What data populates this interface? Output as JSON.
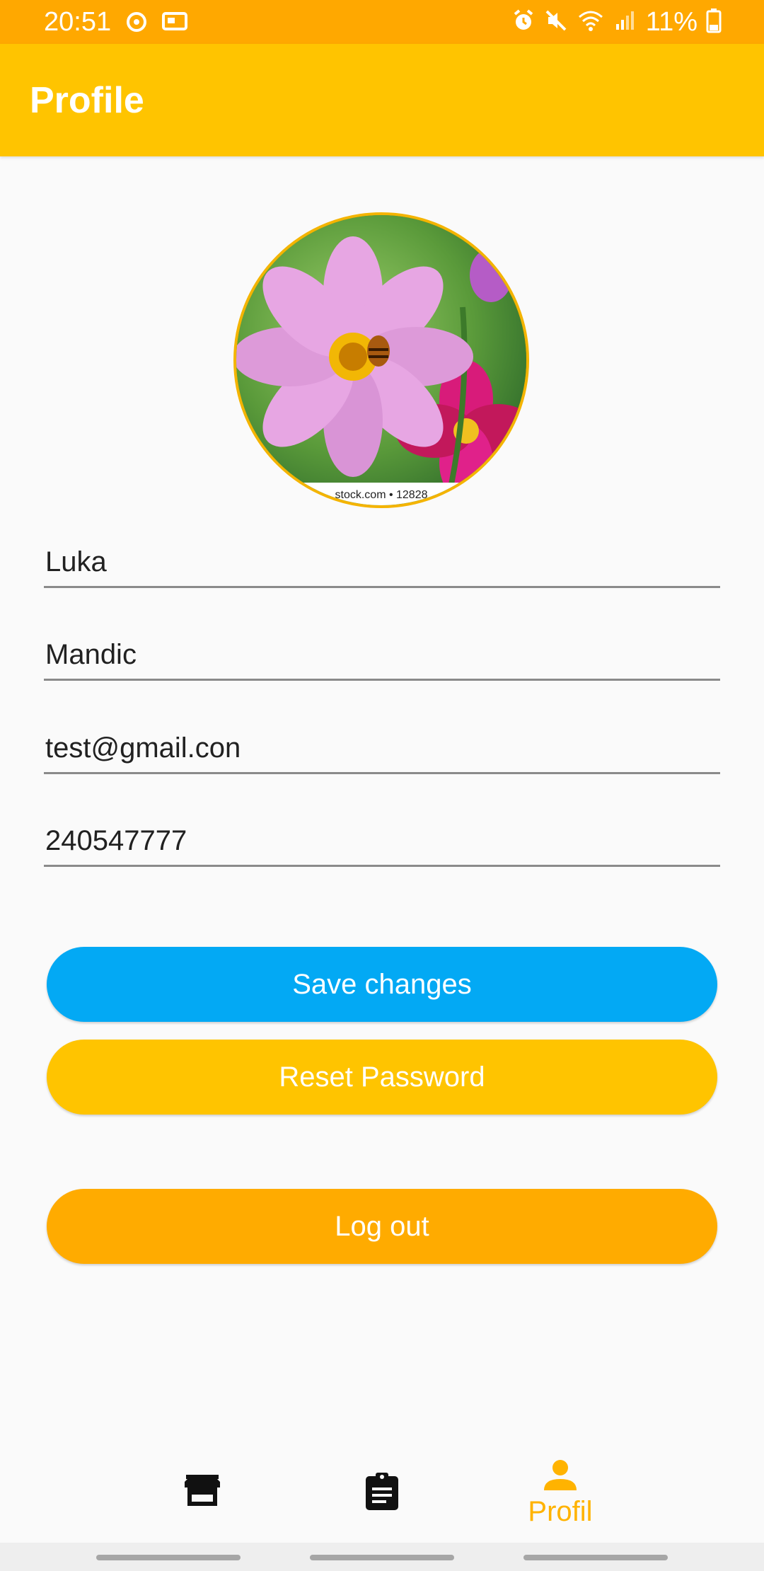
{
  "status_bar": {
    "time": "20:51",
    "battery": "11%",
    "icons": [
      "sync-icon",
      "cast-icon",
      "alarm-icon",
      "mute-icon",
      "wifi-icon",
      "signal-icon",
      "battery-icon"
    ]
  },
  "app_bar": {
    "title": "Profile"
  },
  "avatar": {
    "watermark": "stock.com • 12828"
  },
  "form": {
    "first_name": "Luka",
    "last_name": "Mandic",
    "email": "test@gmail.con",
    "phone": "240547777"
  },
  "buttons": {
    "save": "Save changes",
    "reset": "Reset Password",
    "logout": "Log out"
  },
  "bottom_nav": {
    "items": [
      {
        "icon": "store-icon",
        "label": ""
      },
      {
        "icon": "clipboard-icon",
        "label": ""
      },
      {
        "icon": "person-icon",
        "label": "Profil"
      }
    ],
    "active_color": "#ffb300"
  },
  "colors": {
    "status_bar": "#ffa800",
    "app_bar": "#ffc400",
    "save_button": "#03a9f4",
    "reset_button": "#ffc400",
    "logout_button": "#ffab00"
  }
}
